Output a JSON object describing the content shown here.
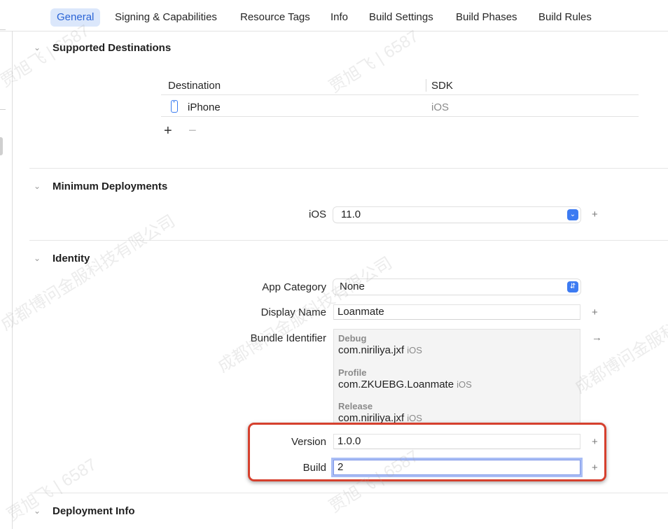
{
  "tabs": [
    {
      "label": "General",
      "active": true
    },
    {
      "label": "Signing & Capabilities",
      "active": false
    },
    {
      "label": "Resource Tags",
      "active": false
    },
    {
      "label": "Info",
      "active": false
    },
    {
      "label": "Build Settings",
      "active": false
    },
    {
      "label": "Build Phases",
      "active": false
    },
    {
      "label": "Build Rules",
      "active": false
    }
  ],
  "supported_destinations": {
    "title": "Supported Destinations",
    "columns": [
      "Destination",
      "SDK"
    ],
    "rows": [
      {
        "destination": "iPhone",
        "sdk": "iOS",
        "icon": "iphone-icon"
      }
    ],
    "add_symbol": "+",
    "remove_symbol": "−"
  },
  "minimum_deployments": {
    "title": "Minimum Deployments",
    "label": "iOS",
    "value": "11.0",
    "add_symbol": "+"
  },
  "identity": {
    "title": "Identity",
    "app_category": {
      "label": "App Category",
      "value": "None"
    },
    "display_name": {
      "label": "Display Name",
      "value": "Loanmate",
      "add_symbol": "+"
    },
    "bundle_identifier": {
      "label": "Bundle Identifier",
      "arrow_symbol": "→",
      "configs": [
        {
          "name": "Debug",
          "value": "com.niriliya.jxf",
          "sdk": "iOS"
        },
        {
          "name": "Profile",
          "value": "com.ZKUEBG.Loanmate",
          "sdk": "iOS"
        },
        {
          "name": "Release",
          "value": "com.niriliya.jxf",
          "sdk": "iOS"
        }
      ]
    },
    "version": {
      "label": "Version",
      "value": "1.0.0",
      "add_symbol": "+"
    },
    "build": {
      "label": "Build",
      "value": "2",
      "add_symbol": "+"
    }
  },
  "deployment_info": {
    "title": "Deployment Info"
  },
  "watermarks": [
    "贾旭飞 | 6587",
    "成都博问金服科技有限公司"
  ],
  "colors": {
    "accent": "#3d7bf2",
    "highlight": "#d6402e",
    "tab_active_bg": "#dbe7fb"
  }
}
